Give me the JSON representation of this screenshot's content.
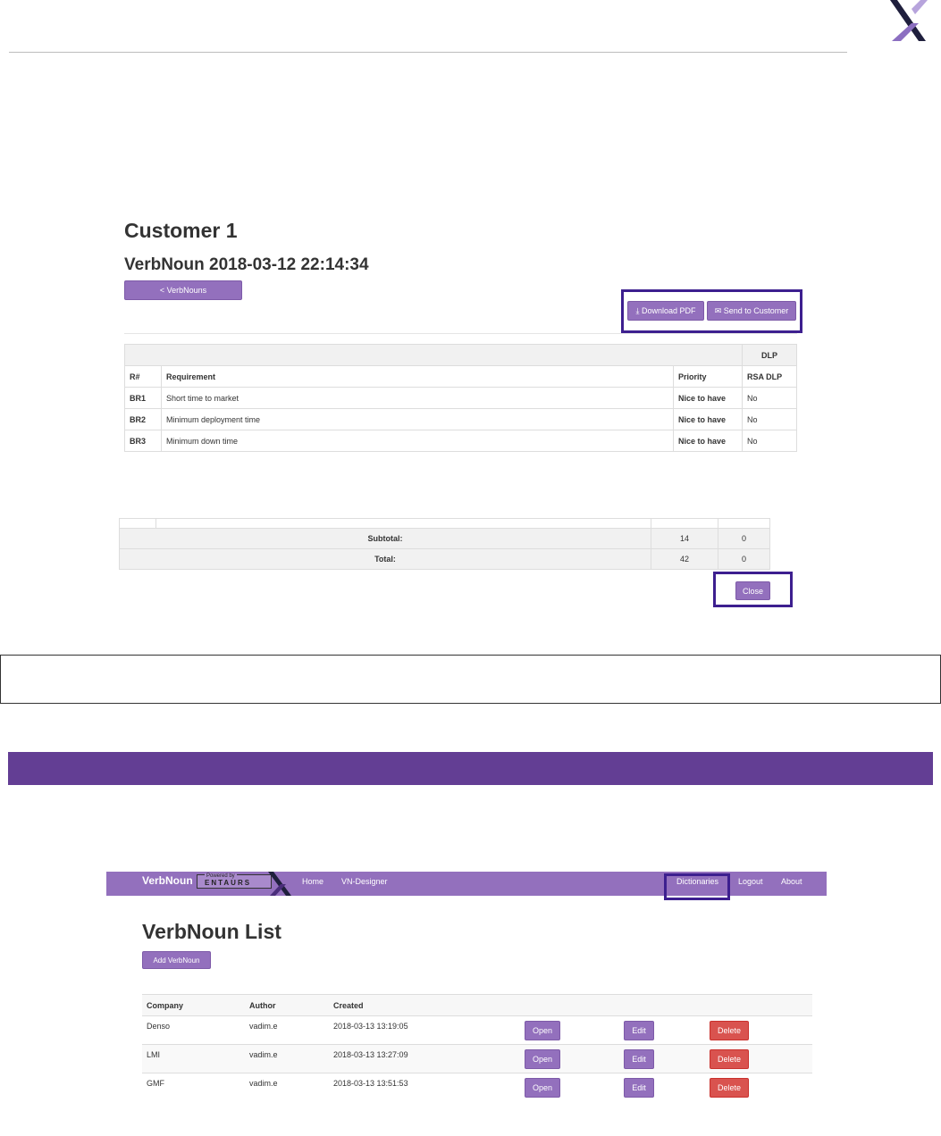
{
  "report": {
    "customer_title": "Customer 1",
    "verbnoun_title": "VerbNoun 2018-03-12 22:14:34",
    "back_button": "< VerbNouns",
    "download_pdf": "⤓ Download PDF",
    "send_to_customer": "✉ Send to Customer",
    "group_header": "DLP",
    "columns": [
      "R#",
      "Requirement",
      "Priority",
      "RSA DLP"
    ],
    "rows": [
      {
        "id": "BR1",
        "requirement": "Short time to market",
        "priority": "Nice to have",
        "dlp": "No"
      },
      {
        "id": "BR2",
        "requirement": "Minimum deployment time",
        "priority": "Nice to have",
        "dlp": "No"
      },
      {
        "id": "BR3",
        "requirement": "Minimum down time",
        "priority": "Nice to have",
        "dlp": "No"
      }
    ],
    "subtotal_label": "Subtotal:",
    "subtotal_a": "14",
    "subtotal_b": "0",
    "total_label": "Total:",
    "total_a": "42",
    "total_b": "0",
    "close_button": "Close"
  },
  "app": {
    "brand": "VerbNoun",
    "powered_by": "Powered by",
    "badge_text": "ENTAURS",
    "nav_left": [
      "Home",
      "VN-Designer"
    ],
    "nav_right": [
      "Dictionaries",
      "Logout",
      "About"
    ],
    "list_title": "VerbNoun List",
    "add_button": "Add VerbNoun",
    "columns": [
      "Company",
      "Author",
      "Created"
    ],
    "rows": [
      {
        "company": "Denso",
        "author": "vadim.e",
        "created": "2018-03-13 13:19:05"
      },
      {
        "company": "LMI",
        "author": "vadim.e",
        "created": "2018-03-13 13:27:09"
      },
      {
        "company": "GMF",
        "author": "vadim.e",
        "created": "2018-03-13 13:51:53"
      }
    ],
    "open_label": "Open",
    "edit_label": "Edit",
    "delete_label": "Delete"
  },
  "colors": {
    "accent_purple": "#9370bd",
    "banner_purple": "#633e94",
    "highlight_border": "#3d1f8f",
    "delete_red": "#d9534f"
  }
}
